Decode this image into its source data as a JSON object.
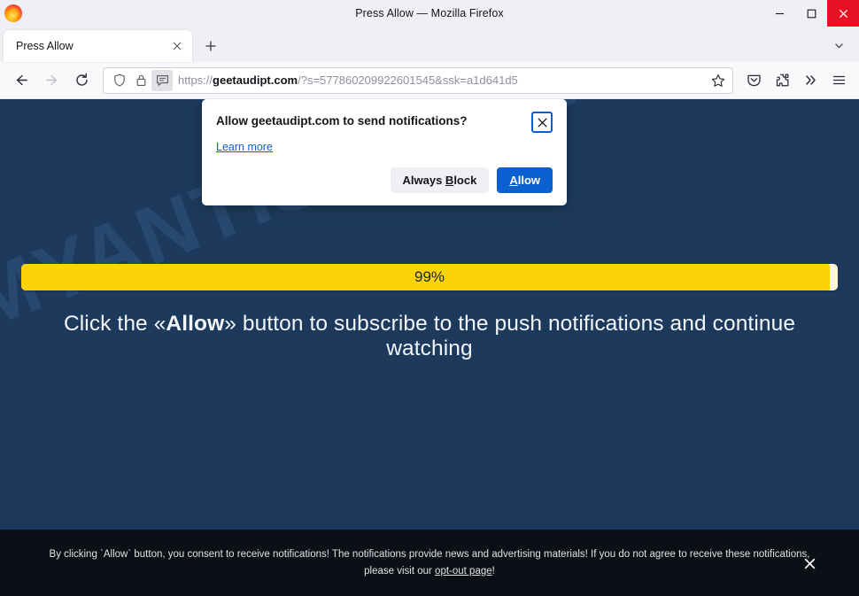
{
  "window": {
    "title": "Press Allow — Mozilla Firefox",
    "minimize_label": "Minimize",
    "maximize_label": "Maximize",
    "close_label": "Close"
  },
  "tabbar": {
    "tabs": [
      {
        "title": "Press Allow",
        "close_label": "Close tab"
      }
    ],
    "new_tab_label": "+",
    "list_tabs_label": "List all tabs"
  },
  "navbar": {
    "back_label": "Go back one page",
    "forward_label": "Go forward one page",
    "reload_label": "Reload current page",
    "url": {
      "scheme": "https://",
      "host": "geetaudipt.com",
      "path": "/?s=577860209922601545&ssk=a1d641d5"
    },
    "bookmark_label": "Bookmark this page",
    "pocket_label": "Save to Pocket",
    "extensions_label": "Extensions",
    "overflow_label": "More tools",
    "menu_label": "Open application menu"
  },
  "permission_dialog": {
    "title": "Allow geetaudipt.com to send notifications?",
    "learn_more": "Learn more",
    "close_label": "Close",
    "block_button": {
      "prefix": "Always ",
      "accesskey": "B",
      "suffix": "lock"
    },
    "allow_button": {
      "accesskey": "A",
      "suffix": "llow"
    }
  },
  "page": {
    "watermark": "MYANTISPYWARE.COM",
    "progress": {
      "percent": 99,
      "label": "99%"
    },
    "headline": {
      "before": "Click the «",
      "emphasis": "Allow",
      "after": "» button to subscribe to the push notifications and continue watching"
    },
    "footer": {
      "text_before": "By clicking `Allow` button, you consent to receive notifications! The notifications provide news and advertising materials! If you do not agree to receive these notifications, please visit our ",
      "link": "opt-out page",
      "text_after": "!",
      "close_label": "✕"
    }
  },
  "colors": {
    "page_background": "#1d3a5c",
    "progress_fill": "#fcd209",
    "progress_track": "#fdf6d8",
    "accent_blue": "#0a60cf",
    "footer_background": "#0c1016",
    "window_close": "#e81123"
  }
}
